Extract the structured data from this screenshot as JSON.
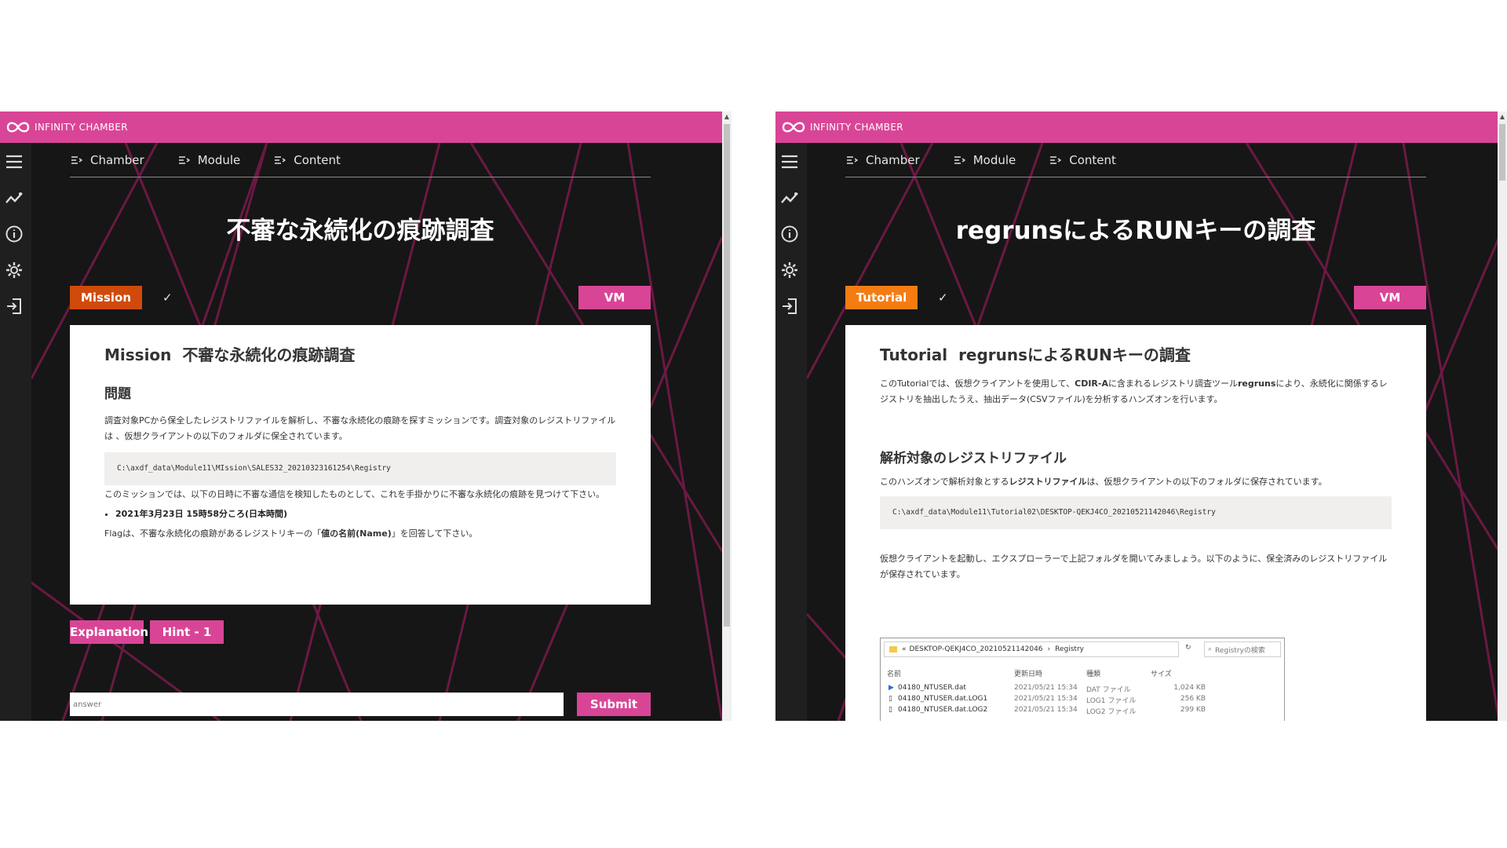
{
  "brand": {
    "name": "INFINITY CHAMBER"
  },
  "left": {
    "nav": [
      "Chamber",
      "Module",
      "Content"
    ],
    "title": "不審な永続化の痕跡調査",
    "badge": "Mission",
    "check": "✓",
    "vm": "VM",
    "card": {
      "heading_prefix": "Mission",
      "heading": "不審な永続化の痕跡調査",
      "section": "問題",
      "para1": "調査対象PCから保全したレジストリファイルを解析し、不審な永続化の痕跡を探すミッションです。調査対象のレジストリファイルは 、仮想クライアントの以下のフォルダに保全されています。",
      "code": "C:\\axdf_data\\Module11\\MIssion\\SALES32_20210323161254\\Registry",
      "para2": "このミッションでは、以下の日時に不審な通信を検知したものとして、これを手掛かりに不審な永続化の痕跡を見つけて下さい。",
      "bullet": "2021年3月23日 15時58分ころ(日本時間)",
      "flag_pre": "Flagは、不審な永続化の痕跡があるレジストリキーの「",
      "flag_bold": "値の名前(Name)",
      "flag_post": "」を回答して下さい。"
    },
    "buttons": {
      "explanation": "Explanation",
      "hint": "Hint - 1",
      "submit": "Submit"
    },
    "answer_placeholder": "answer"
  },
  "right": {
    "nav": [
      "Chamber",
      "Module",
      "Content"
    ],
    "title": "regrunsによるRUNキーの調査",
    "badge": "Tutorial",
    "check": "✓",
    "vm": "VM",
    "card": {
      "heading_prefix": "Tutorial",
      "heading": "regrunsによるRUNキーの調査",
      "intro_1": "このTutorialでは、仮想クライアントを使用して、",
      "intro_b1": "CDIR-A",
      "intro_2": "に含まれるレジストリ調査ツール",
      "intro_b2": "regruns",
      "intro_3": "により、永続化に関係するレジストリを抽出したうえ、抽出データ(CSVファイル)を分析するハンズオンを行います。",
      "section": "解析対象のレジストリファイル",
      "para1_pre": "このハンズオンで解析対象とする",
      "para1_bold": "レジストリファイル",
      "para1_post": "は、仮想クライアントの以下のフォルダに保存されています。",
      "code": "C:\\axdf_data\\Module11\\Tutorial02\\DESKTOP-QEKJ4CO_20210521142046\\Registry",
      "para2": "仮想クライアントを起動し、エクスプローラーで上記フォルダを開いてみましょう。以下のように、保全済みのレジストリファイルが保存されています。"
    },
    "explorer": {
      "path_prefix": "«",
      "path_folder": "DESKTOP-QEKJ4CO_20210521142046",
      "path_sep": "›",
      "path_leaf": "Registry",
      "search": "Registryの検索",
      "columns": [
        "名前",
        "更新日時",
        "種類",
        "サイズ"
      ],
      "rows": [
        {
          "name": "04180_NTUSER.dat",
          "date": "2021/05/21 15:34",
          "type": "DAT ファイル",
          "size": "1,024 KB"
        },
        {
          "name": "04180_NTUSER.dat.LOG1",
          "date": "2021/05/21 15:34",
          "type": "LOG1 ファイル",
          "size": "256 KB"
        },
        {
          "name": "04180_NTUSER.dat.LOG2",
          "date": "2021/05/21 15:34",
          "type": "LOG2 ファイル",
          "size": "299 KB"
        }
      ]
    }
  },
  "colors": {
    "pink": "#d94596",
    "mission_badge": "#d04a0c",
    "tutorial_badge": "#f57c12",
    "dark_bg": "#161616"
  }
}
